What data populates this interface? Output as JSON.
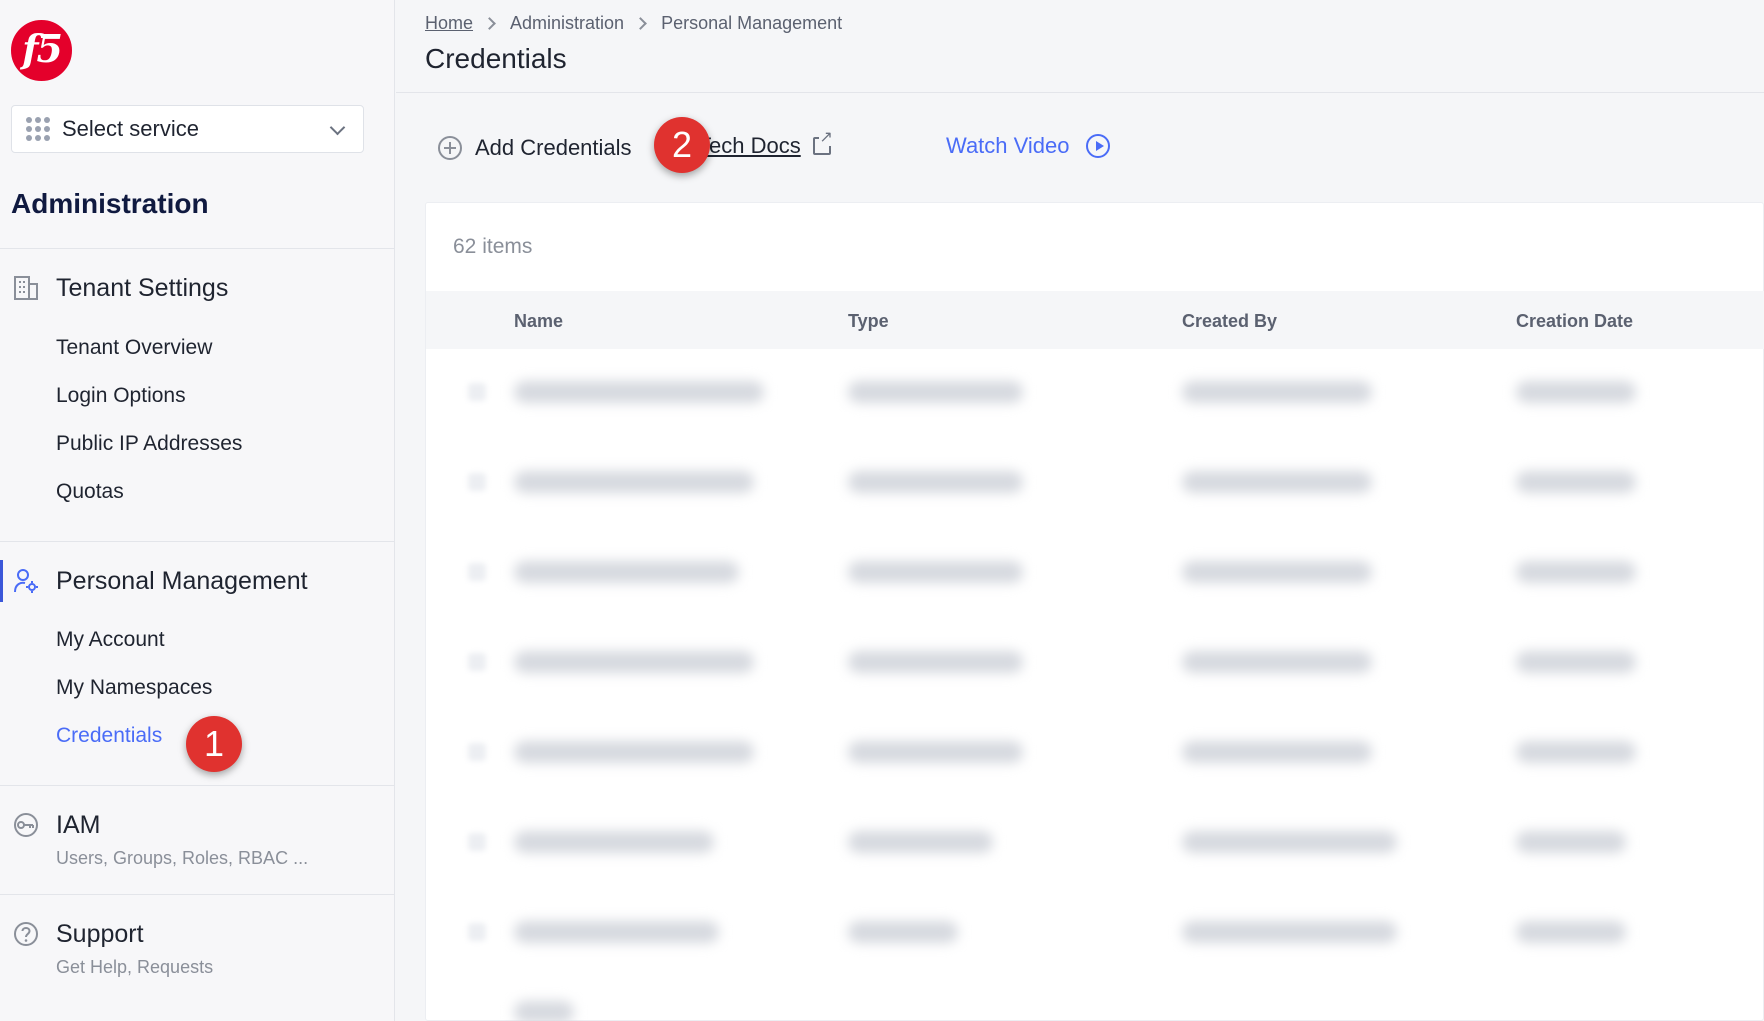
{
  "sidebar": {
    "service_select": {
      "label": "Select service"
    },
    "section_title": "Administration",
    "tenant_settings": {
      "title": "Tenant Settings",
      "items": [
        "Tenant Overview",
        "Login Options",
        "Public IP Addresses",
        "Quotas"
      ]
    },
    "personal_management": {
      "title": "Personal Management",
      "items": [
        "My Account",
        "My Namespaces",
        "Credentials"
      ]
    },
    "iam": {
      "title": "IAM",
      "subtitle": "Users, Groups, Roles, RBAC ..."
    },
    "support": {
      "title": "Support",
      "subtitle": "Get Help, Requests"
    }
  },
  "breadcrumb": [
    "Home",
    "Administration",
    "Personal Management"
  ],
  "page_title": "Credentials",
  "actions": {
    "add_label": "Add Credentials",
    "docs_label": "Tech Docs",
    "video_label": "Watch Video"
  },
  "badges": {
    "one": "1",
    "two": "2"
  },
  "table": {
    "count": "62 items",
    "columns": [
      "Name",
      "Type",
      "Created By",
      "Creation Date"
    ]
  },
  "colors": {
    "accent": "#4a6cf7",
    "brand": "#e4002b",
    "badge": "#e0322f"
  }
}
